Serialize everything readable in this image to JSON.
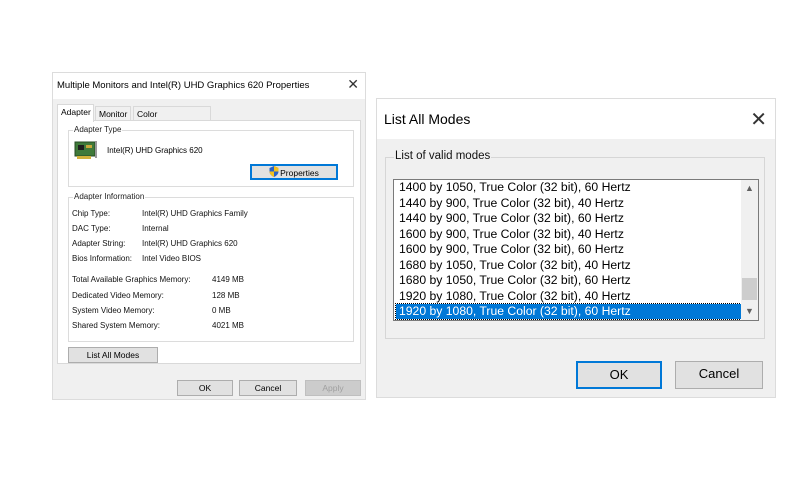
{
  "adapter_dialog": {
    "title": "Multiple Monitors and Intel(R) UHD Graphics 620 Properties",
    "close_icon": "✕",
    "tabs": [
      {
        "label": "Adapter",
        "active": true
      },
      {
        "label": "Monitor",
        "active": false
      },
      {
        "label": "Color Management",
        "active": false
      }
    ],
    "adapter_type": {
      "group_label": "Adapter Type",
      "adapter_name": "Intel(R) UHD Graphics 620",
      "properties_button": "Properties",
      "icon": "graphics-card-icon"
    },
    "adapter_info": {
      "group_label": "Adapter Information",
      "rows": [
        {
          "key": "Chip Type:",
          "value": "Intel(R) UHD Graphics Family"
        },
        {
          "key": "DAC Type:",
          "value": "Internal"
        },
        {
          "key": "Adapter String:",
          "value": "Intel(R) UHD Graphics 620"
        },
        {
          "key": "Bios Information:",
          "value": "Intel Video BIOS"
        }
      ]
    },
    "memory": [
      {
        "key": "Total Available Graphics Memory:",
        "value": "4149 MB"
      },
      {
        "key": "Dedicated Video Memory:",
        "value": "128 MB"
      },
      {
        "key": "System Video Memory:",
        "value": "0 MB"
      },
      {
        "key": "Shared System Memory:",
        "value": "4021 MB"
      }
    ],
    "list_all_modes_button": "List All Modes",
    "ok_button": "OK",
    "cancel_button": "Cancel",
    "apply_button": "Apply"
  },
  "modes_dialog": {
    "title": "List All Modes",
    "close_icon": "✕",
    "group_label": "List of valid modes",
    "modes": [
      "1400 by 1050, True Color (32 bit), 60 Hertz",
      "1440 by 900, True Color (32 bit), 40 Hertz",
      "1440 by 900, True Color (32 bit), 60 Hertz",
      "1600 by 900, True Color (32 bit), 40 Hertz",
      "1600 by 900, True Color (32 bit), 60 Hertz",
      "1680 by 1050, True Color (32 bit), 40 Hertz",
      "1680 by 1050, True Color (32 bit), 60 Hertz",
      "1920 by 1080, True Color (32 bit), 40 Hertz",
      "1920 by 1080, True Color (32 bit), 60 Hertz"
    ],
    "selected_mode": "1920 by 1080, True Color (32 bit), 60 Hertz",
    "scroll_up_icon": "▲",
    "scroll_down_icon": "▼",
    "ok_button": "OK",
    "cancel_button": "Cancel"
  },
  "colors": {
    "selection": "#0078d7",
    "dialog_bg": "#f0f0f0",
    "focus_border": "#0078d7"
  }
}
